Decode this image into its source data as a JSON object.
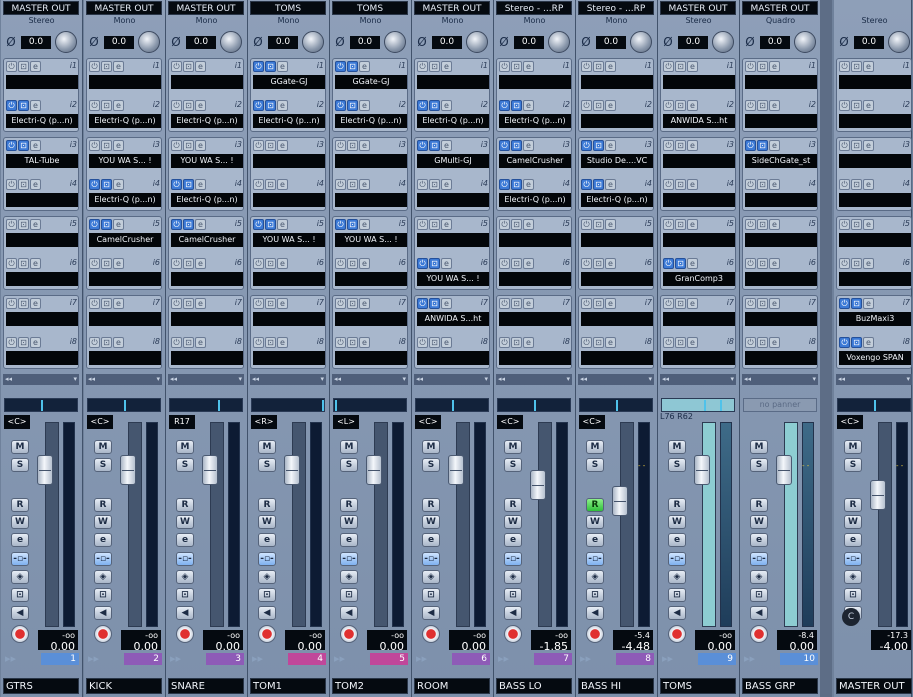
{
  "channels": [
    {
      "name": "GTRS",
      "route": "MASTER OUT",
      "config": "Stereo",
      "gain": "0.0",
      "pan": "<C>",
      "num": "1",
      "num_color": "#5a8fd8",
      "vol": "0.00",
      "peak": "-oo",
      "green_r": false,
      "lit": false,
      "inserts": [
        "",
        "Electri-Q (p...n)",
        "TAL-Tube",
        "",
        "",
        "",
        "",
        ""
      ],
      "on": [
        false,
        true,
        true,
        false,
        false,
        false,
        false,
        false
      ]
    },
    {
      "name": "KICK",
      "route": "MASTER OUT",
      "config": "Mono",
      "gain": "0.0",
      "pan": "<C>",
      "num": "2",
      "num_color": "#8e5bb7",
      "vol": "0.00",
      "peak": "-oo",
      "green_r": false,
      "lit": false,
      "inserts": [
        "",
        "Electri-Q (p...n)",
        "YOU WA S... !",
        "Electri-Q (p...n)",
        "CamelCrusher",
        "",
        "",
        ""
      ],
      "on": [
        false,
        false,
        false,
        true,
        true,
        false,
        false,
        false
      ]
    },
    {
      "name": "SNARE",
      "route": "MASTER OUT",
      "config": "Mono",
      "gain": "0.0",
      "pan": "R17",
      "num": "3",
      "num_color": "#8e5bb7",
      "vol": "0.00",
      "peak": "-oo",
      "green_r": false,
      "lit": false,
      "inserts": [
        "",
        "Electri-Q (p...n)",
        "YOU WA S... !",
        "Electri-Q (p...n)",
        "CamelCrusher",
        "",
        "",
        ""
      ],
      "on": [
        false,
        false,
        false,
        true,
        true,
        false,
        false,
        false
      ]
    },
    {
      "name": "TOM1",
      "route": "TOMS",
      "config": "Mono",
      "gain": "0.0",
      "pan": "<R>",
      "num": "4",
      "num_color": "#c0479a",
      "vol": "0.00",
      "peak": "-oo",
      "green_r": false,
      "lit": false,
      "inserts": [
        "GGate-GJ",
        "Electri-Q (p...n)",
        "",
        "",
        "YOU WA S... !",
        "",
        "",
        ""
      ],
      "on": [
        true,
        true,
        false,
        false,
        true,
        false,
        false,
        false
      ]
    },
    {
      "name": "TOM2",
      "route": "TOMS",
      "config": "Mono",
      "gain": "0.0",
      "pan": "<L>",
      "num": "5",
      "num_color": "#c0479a",
      "vol": "0.00",
      "peak": "-oo",
      "green_r": false,
      "lit": false,
      "inserts": [
        "GGate-GJ",
        "Electri-Q (p...n)",
        "",
        "",
        "YOU WA S... !",
        "",
        "",
        ""
      ],
      "on": [
        true,
        true,
        false,
        false,
        true,
        false,
        false,
        false
      ]
    },
    {
      "name": "ROOM",
      "route": "MASTER OUT",
      "config": "Mono",
      "gain": "0.0",
      "pan": "<C>",
      "num": "6",
      "num_color": "#8e5bb7",
      "vol": "0.00",
      "peak": "-oo",
      "green_r": false,
      "lit": false,
      "inserts": [
        "",
        "Electri-Q (p...n)",
        "GMulti-GJ",
        "",
        "",
        "YOU WA S... !",
        "ANWIDA S...ht",
        ""
      ],
      "on": [
        false,
        true,
        true,
        false,
        false,
        true,
        true,
        false
      ]
    },
    {
      "name": "BASS LO",
      "route": "Stereo - ...RP",
      "config": "Mono",
      "gain": "0.0",
      "pan": "<C>",
      "num": "7",
      "num_color": "#8e5bb7",
      "vol": "-1.85",
      "peak": "-oo",
      "green_r": false,
      "lit": false,
      "inserts": [
        "",
        "Electri-Q (p...n)",
        "CamelCrusher",
        "Electri-Q (p...n)",
        "",
        "",
        "",
        ""
      ],
      "on": [
        false,
        true,
        true,
        true,
        false,
        false,
        false,
        false
      ]
    },
    {
      "name": "BASS HI",
      "route": "Stereo - ...RP",
      "config": "Mono",
      "gain": "0.0",
      "pan": "<C>",
      "num": "8",
      "num_color": "#8e5bb7",
      "vol": "-4.48",
      "peak": "-5.4",
      "green_r": true,
      "lit": false,
      "inserts": [
        "",
        "",
        "Studio De....VC",
        "Electri-Q (p...n)",
        "",
        "",
        "",
        ""
      ],
      "on": [
        false,
        false,
        true,
        true,
        false,
        false,
        false,
        false
      ]
    },
    {
      "name": "TOMS",
      "route": "MASTER OUT",
      "config": "Stereo",
      "gain": "0.0",
      "pan": "L76 R62",
      "num": "9",
      "num_color": "#5a8fd8",
      "vol": "0.00",
      "peak": "-oo",
      "green_r": false,
      "lit": true,
      "inserts": [
        "",
        "ANWIDA S...ht",
        "",
        "",
        "",
        "GranComp3",
        "",
        ""
      ],
      "on": [
        false,
        false,
        false,
        false,
        false,
        true,
        false,
        false
      ]
    },
    {
      "name": "BASS GRP",
      "route": "MASTER OUT",
      "config": "Quadro",
      "gain": "0.0",
      "pan": "no panner",
      "num": "10",
      "num_color": "#5a8fd8",
      "vol": "0.00",
      "peak": "-8.4",
      "green_r": false,
      "lit": true,
      "inserts": [
        "",
        "",
        "SideChGate_st",
        "",
        "",
        "",
        "",
        ""
      ],
      "on": [
        false,
        false,
        true,
        false,
        false,
        false,
        false,
        false
      ]
    }
  ],
  "master": {
    "name": "MASTER OUT",
    "route": "",
    "config": "Stereo",
    "gain": "0.0",
    "pan": "<C>",
    "vol": "-4.00",
    "peak": "-17.3",
    "inserts": [
      "",
      "",
      "",
      "",
      "",
      "",
      "BuzMaxi3",
      "Voxengo SPAN"
    ],
    "on": [
      false,
      false,
      false,
      false,
      false,
      false,
      true,
      true
    ]
  },
  "icons": {
    "phase": "phase-invert-icon",
    "mute": "M",
    "solo": "S",
    "read": "R",
    "write": "W",
    "edit": "e",
    "channel_edit": "channel-settings-icon",
    "monitor": "monitor-icon",
    "lock": "lock-icon",
    "speaker": "speaker-icon",
    "record": "record-icon"
  },
  "slot_numbers": [
    "i1",
    "i2",
    "i3",
    "i4",
    "i5",
    "i6",
    "i7",
    "i8"
  ]
}
